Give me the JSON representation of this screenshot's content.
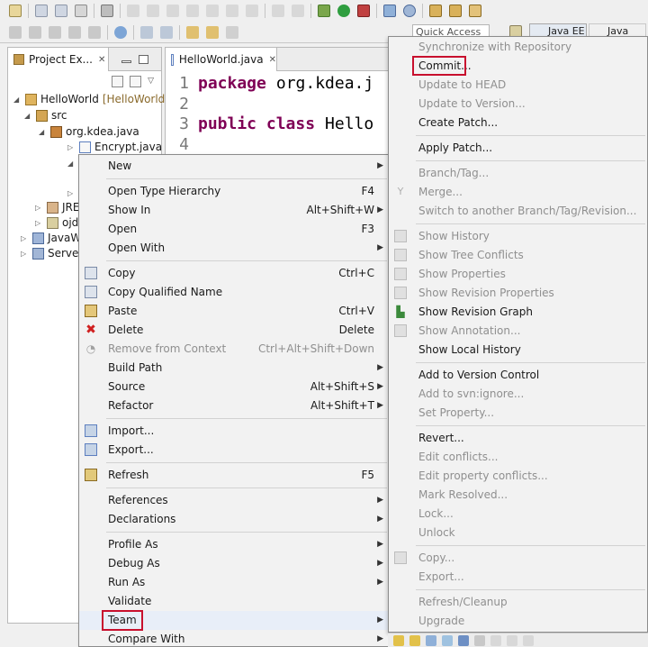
{
  "toolbar": {
    "quick_access_placeholder": "Quick Access",
    "perspective_java_ee": "Java EE",
    "perspective_java": "Java"
  },
  "project_explorer": {
    "tab_label": "Project Ex...",
    "tree": [
      {
        "label": "HelloWorld",
        "suffix": "[HelloWorld"
      },
      {
        "label": "src"
      },
      {
        "label": "org.kdea.java"
      },
      {
        "label": "Encrypt.java"
      },
      {
        "label": "JRE"
      },
      {
        "label": "ojd"
      },
      {
        "label": "JavaWe"
      },
      {
        "label": "Servers"
      }
    ]
  },
  "editor": {
    "tab_label": "HelloWorld.java",
    "lines": [
      {
        "num": "1",
        "keyword": "package",
        "text": "org.kdea.j"
      },
      {
        "num": "2",
        "keyword": "",
        "text": ""
      },
      {
        "num": "3",
        "keyword": "public class",
        "text": "Hello"
      },
      {
        "num": "4",
        "keyword": "",
        "text": ""
      }
    ]
  },
  "context_menu": {
    "items": [
      {
        "label": "New",
        "shortcut": ""
      },
      {
        "label": "Open Type Hierarchy",
        "shortcut": "F4"
      },
      {
        "label": "Show In",
        "shortcut": "Alt+Shift+W"
      },
      {
        "label": "Open",
        "shortcut": "F3"
      },
      {
        "label": "Open With",
        "shortcut": ""
      },
      {
        "label": "Copy",
        "shortcut": "Ctrl+C"
      },
      {
        "label": "Copy Qualified Name",
        "shortcut": ""
      },
      {
        "label": "Paste",
        "shortcut": "Ctrl+V"
      },
      {
        "label": "Delete",
        "shortcut": "Delete"
      },
      {
        "label": "Remove from Context",
        "shortcut": "Ctrl+Alt+Shift+Down"
      },
      {
        "label": "Build Path",
        "shortcut": ""
      },
      {
        "label": "Source",
        "shortcut": "Alt+Shift+S"
      },
      {
        "label": "Refactor",
        "shortcut": "Alt+Shift+T"
      },
      {
        "label": "Import...",
        "shortcut": ""
      },
      {
        "label": "Export...",
        "shortcut": ""
      },
      {
        "label": "Refresh",
        "shortcut": "F5"
      },
      {
        "label": "References",
        "shortcut": ""
      },
      {
        "label": "Declarations",
        "shortcut": ""
      },
      {
        "label": "Profile As",
        "shortcut": ""
      },
      {
        "label": "Debug As",
        "shortcut": ""
      },
      {
        "label": "Run As",
        "shortcut": ""
      },
      {
        "label": "Validate",
        "shortcut": ""
      },
      {
        "label": "Team",
        "shortcut": ""
      },
      {
        "label": "Compare With",
        "shortcut": ""
      }
    ]
  },
  "team_menu": {
    "items": [
      {
        "label": "Synchronize with Repository"
      },
      {
        "label": "Commit..."
      },
      {
        "label": "Update to HEAD"
      },
      {
        "label": "Update to Version..."
      },
      {
        "label": "Create Patch..."
      },
      {
        "label": "Apply Patch..."
      },
      {
        "label": "Branch/Tag..."
      },
      {
        "label": "Merge..."
      },
      {
        "label": "Switch to another Branch/Tag/Revision..."
      },
      {
        "label": "Show History"
      },
      {
        "label": "Show Tree Conflicts"
      },
      {
        "label": "Show Properties"
      },
      {
        "label": "Show Revision Properties"
      },
      {
        "label": "Show Revision Graph"
      },
      {
        "label": "Show Annotation..."
      },
      {
        "label": "Show Local History"
      },
      {
        "label": "Add to Version Control"
      },
      {
        "label": "Add to svn:ignore..."
      },
      {
        "label": "Set Property..."
      },
      {
        "label": "Revert..."
      },
      {
        "label": "Edit conflicts..."
      },
      {
        "label": "Edit property conflicts..."
      },
      {
        "label": "Mark Resolved..."
      },
      {
        "label": "Lock..."
      },
      {
        "label": "Unlock"
      },
      {
        "label": "Copy..."
      },
      {
        "label": "Export..."
      },
      {
        "label": "Refresh/Cleanup"
      },
      {
        "label": "Upgrade"
      }
    ]
  },
  "colors": {
    "highlight_box": "#c8102e",
    "java_keyword": "#7f0055",
    "disabled_text": "#8f8f8f"
  }
}
